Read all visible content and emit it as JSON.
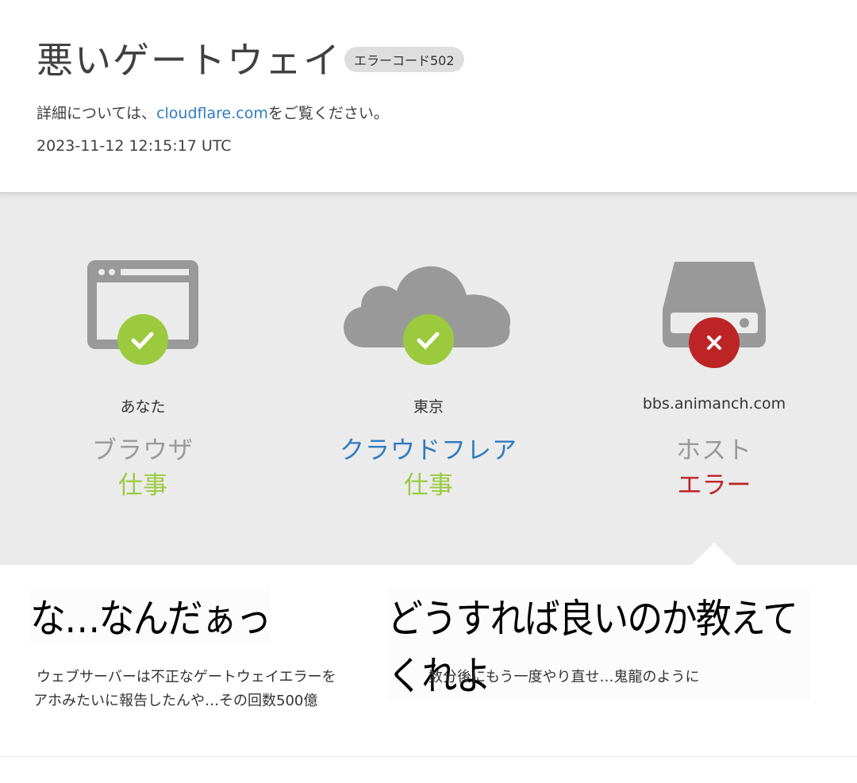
{
  "header": {
    "title": "悪いゲートウェイ",
    "badge": "エラーコード502",
    "info_pre": "詳細については、",
    "info_link": "cloudflare.com",
    "info_post": "をご覧ください。",
    "timestamp": "2023-11-12 12:15:17 UTC"
  },
  "nodes": [
    {
      "location": "あなた",
      "name": "ブラウザ",
      "status": "仕事",
      "icon": "browser-icon",
      "state": "ok"
    },
    {
      "location": "東京",
      "name": "クラウドフレア",
      "status": "仕事",
      "icon": "cloud-icon",
      "state": "ok"
    },
    {
      "location": "bbs.animanch.com",
      "name": "ホスト",
      "status": "エラー",
      "icon": "server-icon",
      "state": "error"
    }
  ],
  "colors": {
    "ok": "#9bca3e",
    "error": "#bd2426",
    "icon": "#999999",
    "link": "#2f7bbf"
  },
  "what_happened": {
    "heading": "な…なんだぁっ",
    "body_line1": "ウェブサーバーは不正なゲートウェイエラーを",
    "body_line2": "アホみたいに報告したんや…その回数500億"
  },
  "what_to_do": {
    "heading": "どうすれば良いのか教えてくれよ",
    "body": "数分後にもう一度やり直せ…鬼龍のように"
  }
}
